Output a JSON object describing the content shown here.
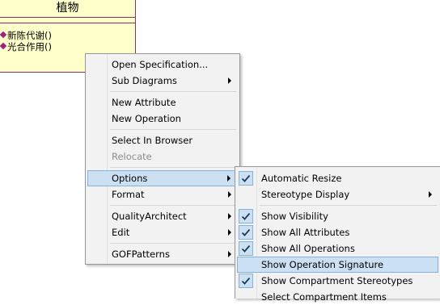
{
  "uml_class": {
    "name": "植物",
    "operations": [
      "新陈代谢()",
      "光合作用()"
    ]
  },
  "context_menu": {
    "items": [
      {
        "label": "Open Specification..."
      },
      {
        "label": "Sub Diagrams",
        "submenu": true
      },
      {
        "label": "New Attribute"
      },
      {
        "label": "New Operation"
      },
      {
        "label": "Select In Browser"
      },
      {
        "label": "Relocate",
        "disabled": true
      },
      {
        "label": "Options",
        "submenu": true,
        "highlighted": true
      },
      {
        "label": "Format",
        "submenu": true
      },
      {
        "label": "QualityArchitect",
        "submenu": true
      },
      {
        "label": "Edit",
        "submenu": true
      },
      {
        "label": "GOFPatterns",
        "submenu": true
      }
    ]
  },
  "options_submenu": {
    "items": [
      {
        "label": "Automatic Resize",
        "checked": true
      },
      {
        "label": "Stereotype Display",
        "submenu": true
      },
      {
        "label": "Show Visibility",
        "checked": true
      },
      {
        "label": "Show All Attributes",
        "checked": true
      },
      {
        "label": "Show All Operations",
        "checked": true
      },
      {
        "label": "Show Operation Signature",
        "highlighted": true
      },
      {
        "label": "Show Compartment Stereotypes",
        "checked": true
      },
      {
        "label": "Select Compartment Items"
      }
    ]
  },
  "colors": {
    "menu_bg": "#f2f2f2",
    "highlight": "#cce0f4",
    "class_fill": "#ffffcc",
    "class_border": "#9b2d5e"
  },
  "icons": {
    "check": "check-icon",
    "submenu": "submenu-arrow-icon",
    "operation": "operation-diamond-icon"
  }
}
